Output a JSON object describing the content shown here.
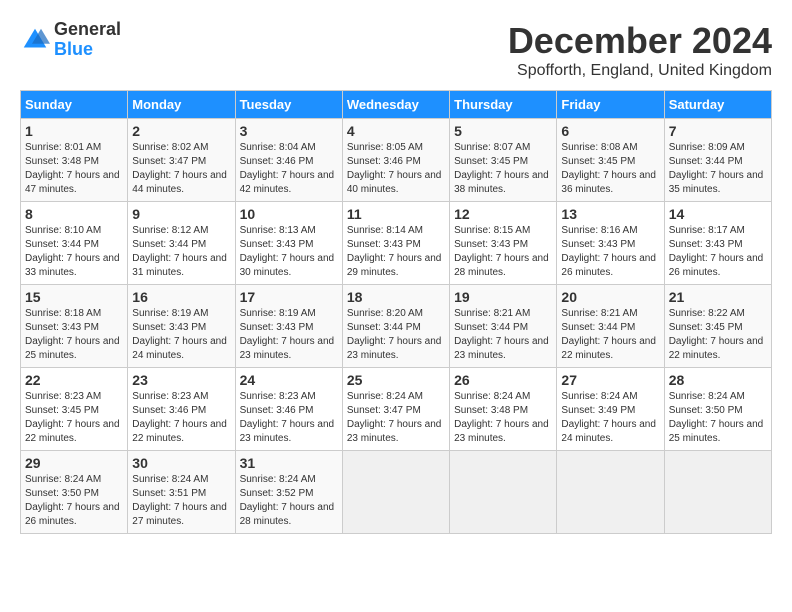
{
  "logo": {
    "general": "General",
    "blue": "Blue"
  },
  "title": "December 2024",
  "location": "Spofforth, England, United Kingdom",
  "days_of_week": [
    "Sunday",
    "Monday",
    "Tuesday",
    "Wednesday",
    "Thursday",
    "Friday",
    "Saturday"
  ],
  "weeks": [
    [
      {
        "day": "1",
        "sunrise": "8:01 AM",
        "sunset": "3:48 PM",
        "daylight": "7 hours and 47 minutes."
      },
      {
        "day": "2",
        "sunrise": "8:02 AM",
        "sunset": "3:47 PM",
        "daylight": "7 hours and 44 minutes."
      },
      {
        "day": "3",
        "sunrise": "8:04 AM",
        "sunset": "3:46 PM",
        "daylight": "7 hours and 42 minutes."
      },
      {
        "day": "4",
        "sunrise": "8:05 AM",
        "sunset": "3:46 PM",
        "daylight": "7 hours and 40 minutes."
      },
      {
        "day": "5",
        "sunrise": "8:07 AM",
        "sunset": "3:45 PM",
        "daylight": "7 hours and 38 minutes."
      },
      {
        "day": "6",
        "sunrise": "8:08 AM",
        "sunset": "3:45 PM",
        "daylight": "7 hours and 36 minutes."
      },
      {
        "day": "7",
        "sunrise": "8:09 AM",
        "sunset": "3:44 PM",
        "daylight": "7 hours and 35 minutes."
      }
    ],
    [
      {
        "day": "8",
        "sunrise": "8:10 AM",
        "sunset": "3:44 PM",
        "daylight": "7 hours and 33 minutes."
      },
      {
        "day": "9",
        "sunrise": "8:12 AM",
        "sunset": "3:44 PM",
        "daylight": "7 hours and 31 minutes."
      },
      {
        "day": "10",
        "sunrise": "8:13 AM",
        "sunset": "3:43 PM",
        "daylight": "7 hours and 30 minutes."
      },
      {
        "day": "11",
        "sunrise": "8:14 AM",
        "sunset": "3:43 PM",
        "daylight": "7 hours and 29 minutes."
      },
      {
        "day": "12",
        "sunrise": "8:15 AM",
        "sunset": "3:43 PM",
        "daylight": "7 hours and 28 minutes."
      },
      {
        "day": "13",
        "sunrise": "8:16 AM",
        "sunset": "3:43 PM",
        "daylight": "7 hours and 26 minutes."
      },
      {
        "day": "14",
        "sunrise": "8:17 AM",
        "sunset": "3:43 PM",
        "daylight": "7 hours and 26 minutes."
      }
    ],
    [
      {
        "day": "15",
        "sunrise": "8:18 AM",
        "sunset": "3:43 PM",
        "daylight": "7 hours and 25 minutes."
      },
      {
        "day": "16",
        "sunrise": "8:19 AM",
        "sunset": "3:43 PM",
        "daylight": "7 hours and 24 minutes."
      },
      {
        "day": "17",
        "sunrise": "8:19 AM",
        "sunset": "3:43 PM",
        "daylight": "7 hours and 23 minutes."
      },
      {
        "day": "18",
        "sunrise": "8:20 AM",
        "sunset": "3:44 PM",
        "daylight": "7 hours and 23 minutes."
      },
      {
        "day": "19",
        "sunrise": "8:21 AM",
        "sunset": "3:44 PM",
        "daylight": "7 hours and 23 minutes."
      },
      {
        "day": "20",
        "sunrise": "8:21 AM",
        "sunset": "3:44 PM",
        "daylight": "7 hours and 22 minutes."
      },
      {
        "day": "21",
        "sunrise": "8:22 AM",
        "sunset": "3:45 PM",
        "daylight": "7 hours and 22 minutes."
      }
    ],
    [
      {
        "day": "22",
        "sunrise": "8:23 AM",
        "sunset": "3:45 PM",
        "daylight": "7 hours and 22 minutes."
      },
      {
        "day": "23",
        "sunrise": "8:23 AM",
        "sunset": "3:46 PM",
        "daylight": "7 hours and 22 minutes."
      },
      {
        "day": "24",
        "sunrise": "8:23 AM",
        "sunset": "3:46 PM",
        "daylight": "7 hours and 23 minutes."
      },
      {
        "day": "25",
        "sunrise": "8:24 AM",
        "sunset": "3:47 PM",
        "daylight": "7 hours and 23 minutes."
      },
      {
        "day": "26",
        "sunrise": "8:24 AM",
        "sunset": "3:48 PM",
        "daylight": "7 hours and 23 minutes."
      },
      {
        "day": "27",
        "sunrise": "8:24 AM",
        "sunset": "3:49 PM",
        "daylight": "7 hours and 24 minutes."
      },
      {
        "day": "28",
        "sunrise": "8:24 AM",
        "sunset": "3:50 PM",
        "daylight": "7 hours and 25 minutes."
      }
    ],
    [
      {
        "day": "29",
        "sunrise": "8:24 AM",
        "sunset": "3:50 PM",
        "daylight": "7 hours and 26 minutes."
      },
      {
        "day": "30",
        "sunrise": "8:24 AM",
        "sunset": "3:51 PM",
        "daylight": "7 hours and 27 minutes."
      },
      {
        "day": "31",
        "sunrise": "8:24 AM",
        "sunset": "3:52 PM",
        "daylight": "7 hours and 28 minutes."
      },
      null,
      null,
      null,
      null
    ]
  ],
  "labels": {
    "sunrise": "Sunrise:",
    "sunset": "Sunset:",
    "daylight": "Daylight:"
  }
}
